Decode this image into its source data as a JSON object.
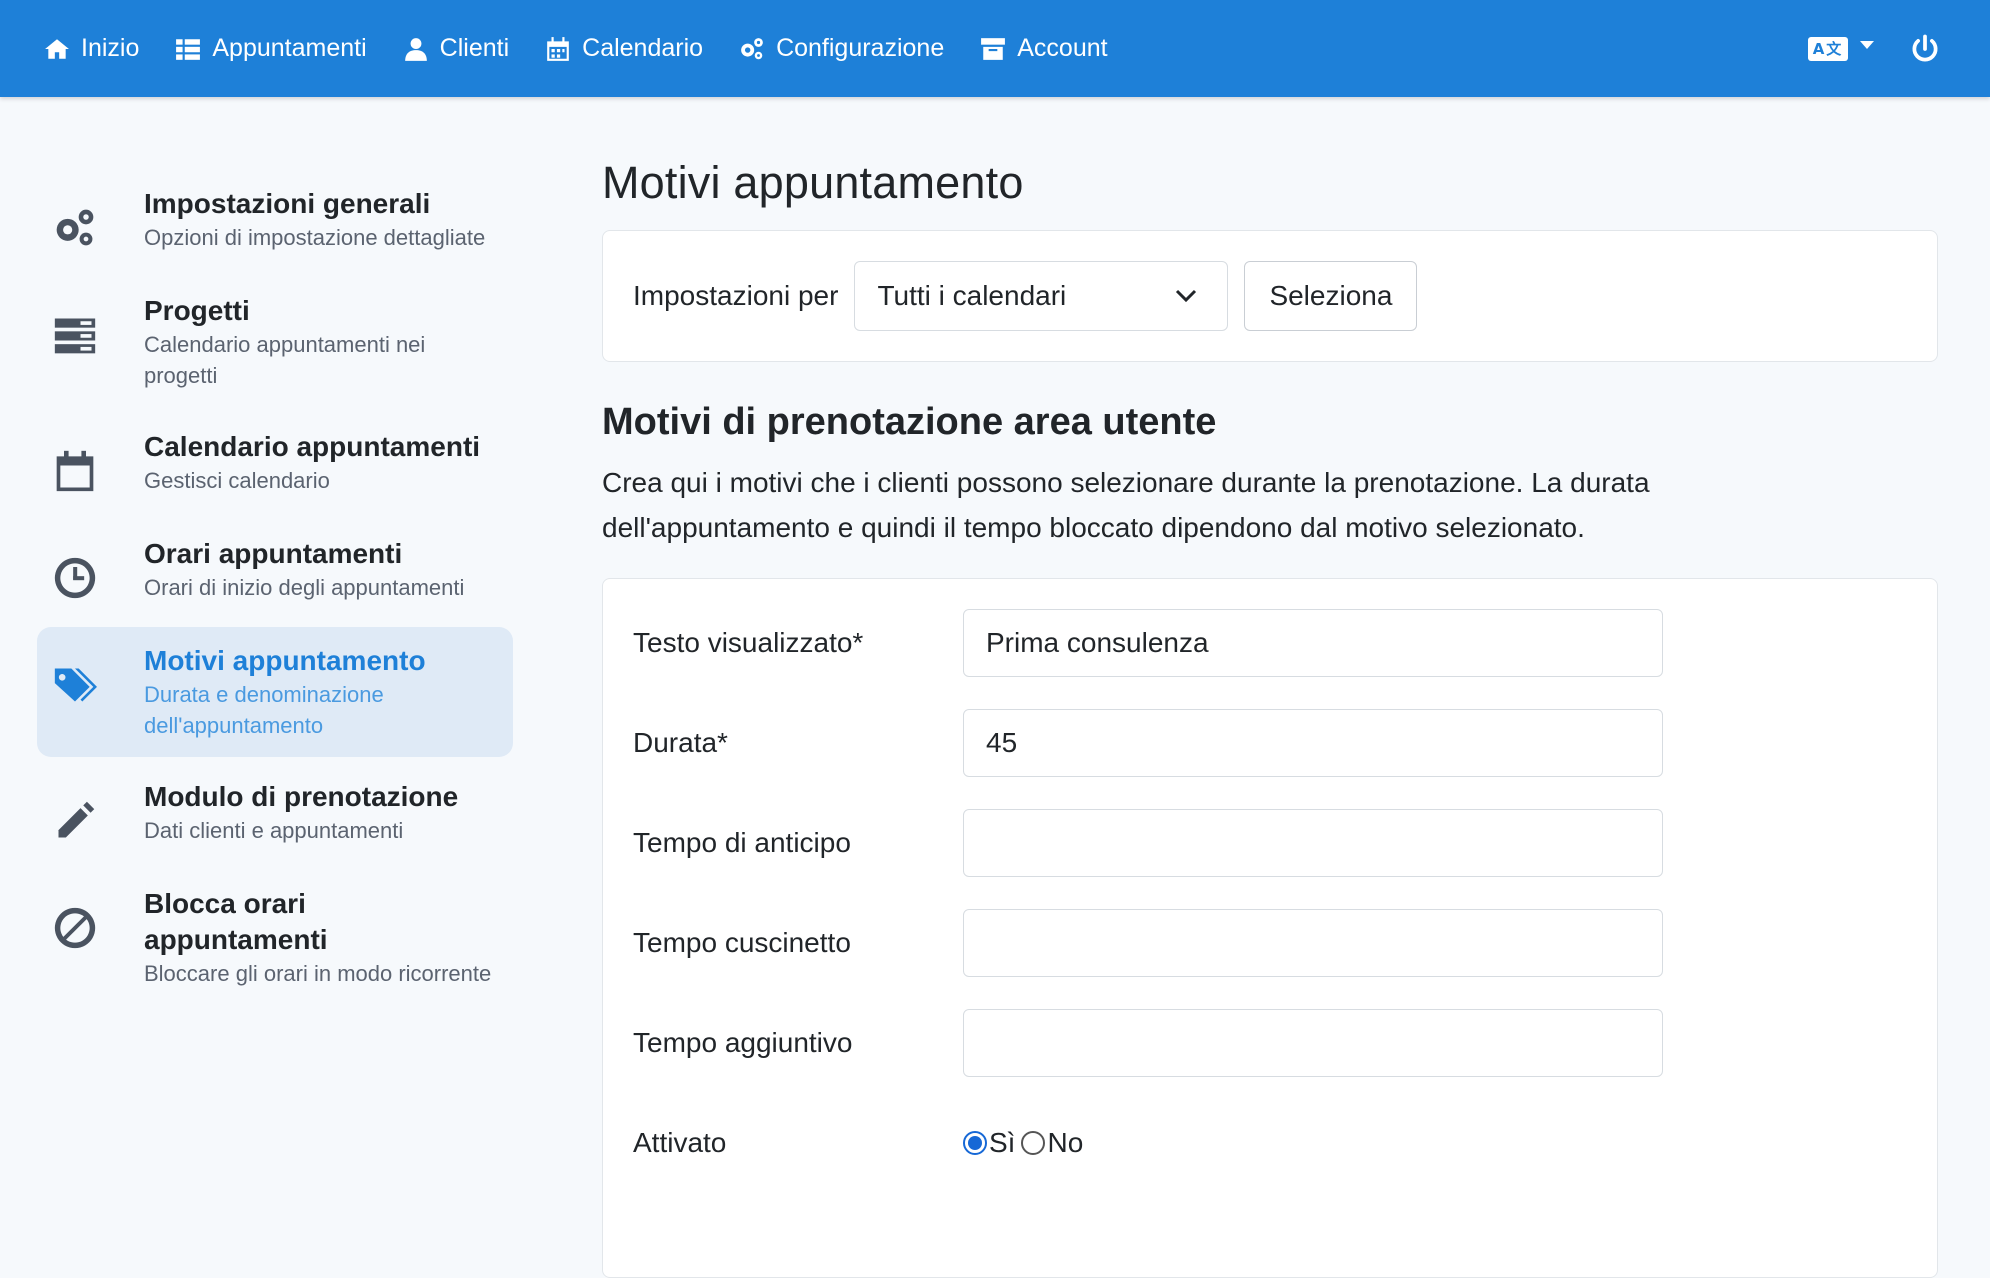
{
  "nav": {
    "items": [
      {
        "label": "Inizio",
        "icon": "home-icon"
      },
      {
        "label": "Appuntamenti",
        "icon": "list-icon"
      },
      {
        "label": "Clienti",
        "icon": "user-icon"
      },
      {
        "label": "Calendario",
        "icon": "calendar-icon"
      },
      {
        "label": "Configurazione",
        "icon": "gears-icon"
      },
      {
        "label": "Account",
        "icon": "archive-icon"
      }
    ],
    "language_icon": "language-icon",
    "power_icon": "power-icon"
  },
  "sidebar": {
    "items": [
      {
        "title": "Impostazioni generali",
        "sub": "Opzioni di impostazione dettagliate",
        "icon": "gears-icon"
      },
      {
        "title": "Progetti",
        "sub": "Calendario appuntamenti nei progetti",
        "icon": "server-icon"
      },
      {
        "title": "Calendario appuntamenti",
        "sub": "Gestisci calendario",
        "icon": "calendar-icon"
      },
      {
        "title": "Orari appuntamenti",
        "sub": "Orari di inizio degli appuntamenti",
        "icon": "clock-icon"
      },
      {
        "title": "Motivi appuntamento",
        "sub": "Durata e denominazione dell'appuntamento",
        "icon": "tags-icon",
        "active": true
      },
      {
        "title": "Modulo di prenotazione",
        "sub": "Dati clienti e appuntamenti",
        "icon": "pencil-icon"
      },
      {
        "title": "Blocca orari appuntamenti",
        "sub": "Bloccare gli orari in modo ricorrente",
        "icon": "ban-icon"
      }
    ]
  },
  "main": {
    "title": "Motivi appuntamento",
    "filter": {
      "label": "Impostazioni per",
      "selected": "Tutti i calendari",
      "button": "Seleziona"
    },
    "section_title": "Motivi di prenotazione area utente",
    "section_desc": "Crea qui i motivi che i clienti possono selezionare durante la prenotazione. La durata dell'appuntamento e quindi il tempo bloccato dipendono dal motivo selezionato.",
    "form": {
      "display_text_label": "Testo visualizzato*",
      "display_text_value": "Prima consulenza",
      "duration_label": "Durata*",
      "duration_value": "45",
      "lead_time_label": "Tempo di anticipo",
      "lead_time_value": "",
      "buffer_label": "Tempo cuscinetto",
      "buffer_value": "",
      "extra_label": "Tempo aggiuntivo",
      "extra_value": "",
      "enabled_label": "Attivato",
      "yes_label": "Sì",
      "no_label": "No",
      "enabled": "Sì"
    }
  },
  "colors": {
    "topbar": "#1e80d8",
    "active_bg": "#dfeaf6",
    "accent": "#1e80d8"
  }
}
